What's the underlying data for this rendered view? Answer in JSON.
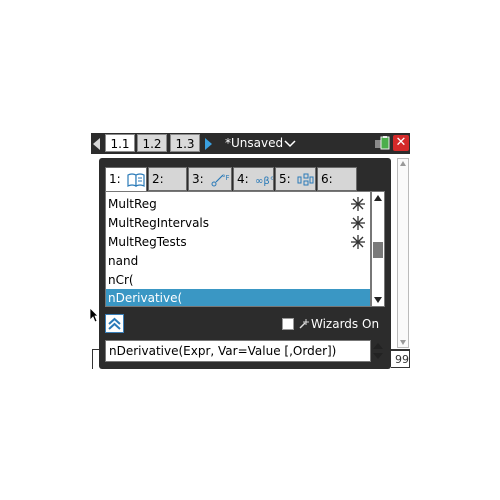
{
  "header": {
    "page_tabs": [
      {
        "label": "1.1",
        "active": true
      },
      {
        "label": "1.2",
        "active": false
      },
      {
        "label": "1.3",
        "active": false
      }
    ],
    "document_title": "*Unsaved"
  },
  "catalog": {
    "tabs": [
      {
        "label": "1:",
        "icon": "book-icon",
        "active": true
      },
      {
        "label": "2:",
        "icon": "integral-sigma-icon",
        "active": false
      },
      {
        "label": "3:",
        "icon": "units-icon",
        "active": false
      },
      {
        "label": "4:",
        "icon": "greek-symbols-icon",
        "active": false
      },
      {
        "label": "5:",
        "icon": "math-templates-icon",
        "active": false
      },
      {
        "label": "6:",
        "icon": "library-icon",
        "active": false
      }
    ],
    "items": [
      {
        "label": "MultReg",
        "wizard": true,
        "selected": false
      },
      {
        "label": "MultRegIntervals",
        "wizard": true,
        "selected": false
      },
      {
        "label": "MultRegTests",
        "wizard": true,
        "selected": false
      },
      {
        "label": "nand",
        "wizard": false,
        "selected": false
      },
      {
        "label": "nCr(",
        "wizard": false,
        "selected": false
      },
      {
        "label": "nDerivative(",
        "wizard": false,
        "selected": true
      }
    ],
    "wizards_on_label": "Wizards On",
    "wizards_on_checked": false,
    "syntax_help": "nDerivative(Expr, Var=Value [,Order])"
  },
  "background": {
    "partial_value": "99"
  },
  "colors": {
    "selection": "#3a97c4",
    "frame": "#2c2c2c",
    "close": "#d42a2a"
  }
}
